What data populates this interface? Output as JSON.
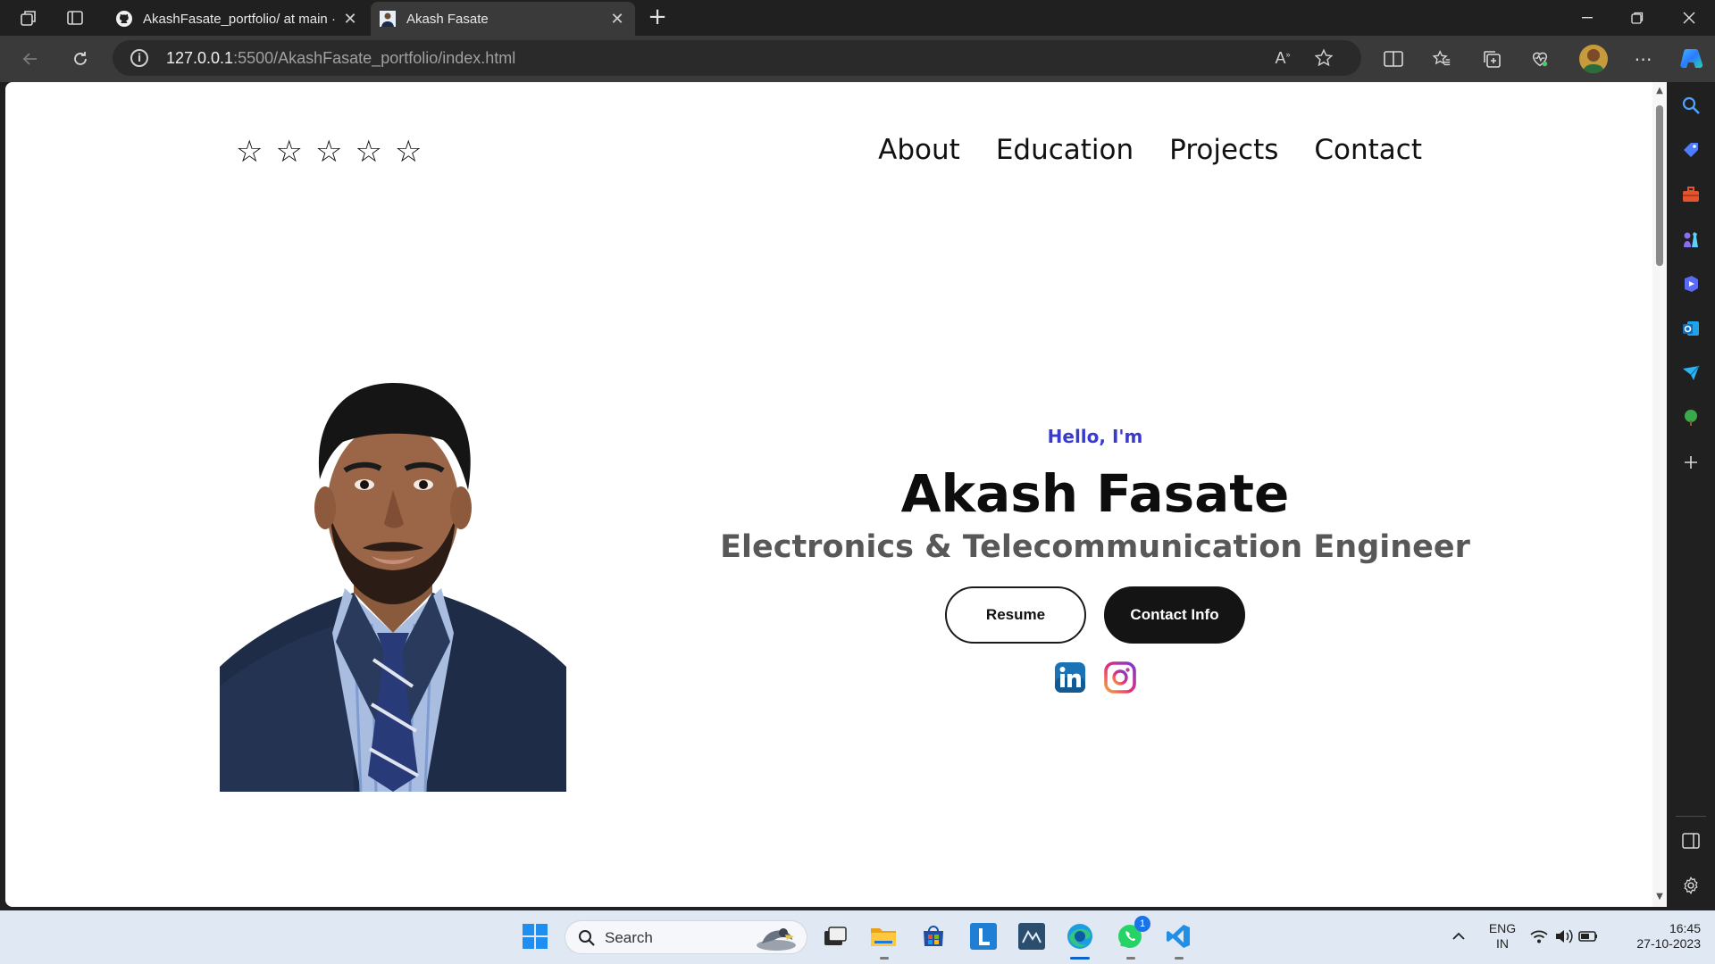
{
  "browser": {
    "tabs": [
      {
        "title": "AkashFasate_portfolio/ at main ·",
        "active": false,
        "favicon": "github-icon"
      },
      {
        "title": "Akash Fasate",
        "active": true,
        "favicon": "profile-photo-favicon"
      }
    ],
    "address": {
      "host": "127.0.0.1",
      "rest": ":5500/AkashFasate_portfolio/index.html"
    }
  },
  "page": {
    "stars": [
      "☆",
      "☆",
      "☆",
      "☆",
      "☆"
    ],
    "nav": [
      "About",
      "Education",
      "Projects",
      "Contact"
    ],
    "hello": "Hello, I'm",
    "name": "Akash Fasate",
    "role": "Electronics & Telecommunication Engineer",
    "buttons": {
      "resume": "Resume",
      "contact": "Contact Info"
    },
    "socials": [
      "linkedin-icon",
      "instagram-icon"
    ]
  },
  "taskbar": {
    "search_label": "Search",
    "whatsapp_badge": "1",
    "lang": {
      "line1": "ENG",
      "line2": "IN"
    },
    "clock": {
      "time": "16:45",
      "date": "27-10-2023"
    }
  },
  "colors": {
    "accent_hello": "#3a3ad0",
    "button_dark": "#141414",
    "taskbar_bg": "#dfe8f3"
  }
}
